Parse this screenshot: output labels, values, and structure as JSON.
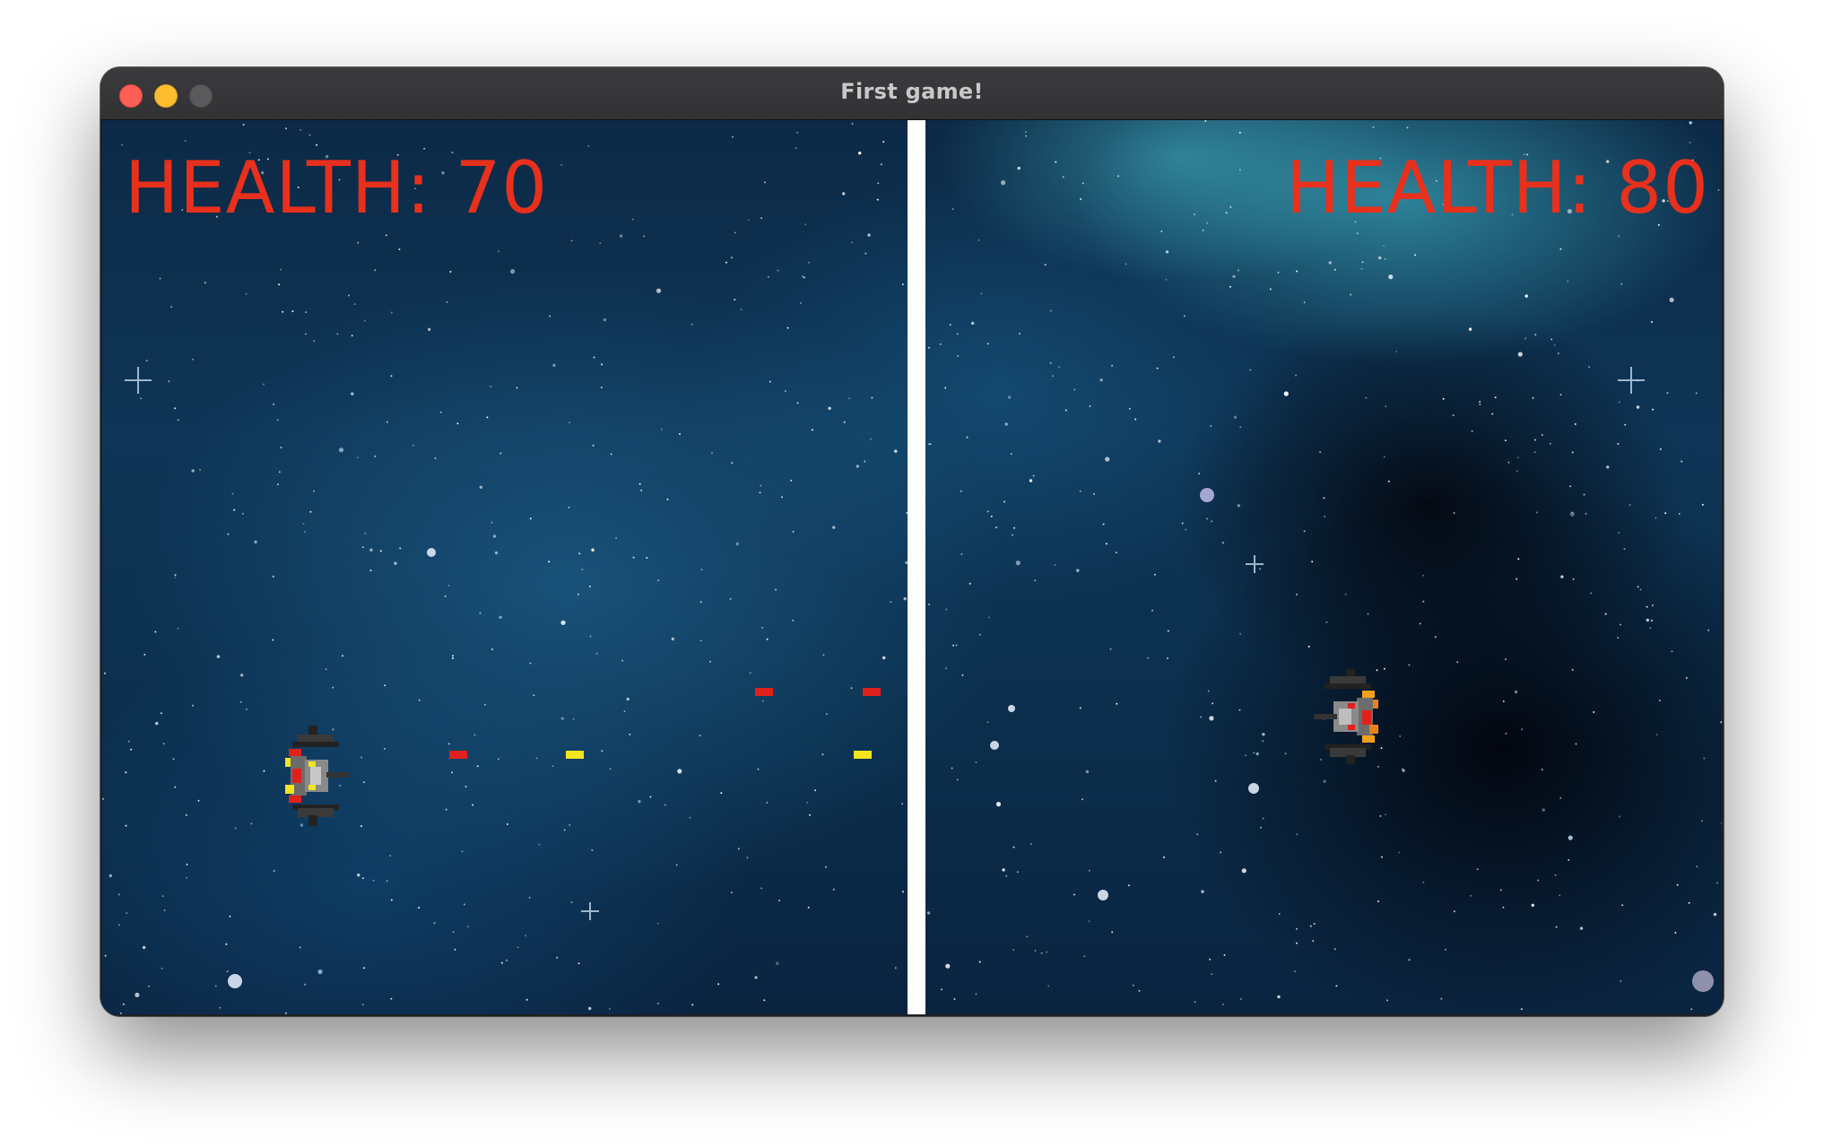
{
  "window": {
    "title": "First game!",
    "controls": [
      "close",
      "minimize",
      "maximize"
    ]
  },
  "game": {
    "background": "starfield",
    "player_left": {
      "health_label": "HEALTH: 70",
      "health": 70,
      "ship_color": "yellow"
    },
    "player_right": {
      "health_label": "HEALTH: 80",
      "health": 80,
      "ship_color": "red"
    },
    "bullets": [
      {
        "owner": "left",
        "color": "#e0211b"
      },
      {
        "owner": "left",
        "color": "#f2e51c"
      },
      {
        "owner": "left",
        "color": "#f2e51c"
      },
      {
        "owner": "right",
        "color": "#e0211b"
      },
      {
        "owner": "right",
        "color": "#e0211b"
      }
    ],
    "colors": {
      "health_text": "#e8301c",
      "divider": "#ffffff",
      "red_bullet": "#e0211b",
      "yellow_bullet": "#f2e51c"
    }
  }
}
